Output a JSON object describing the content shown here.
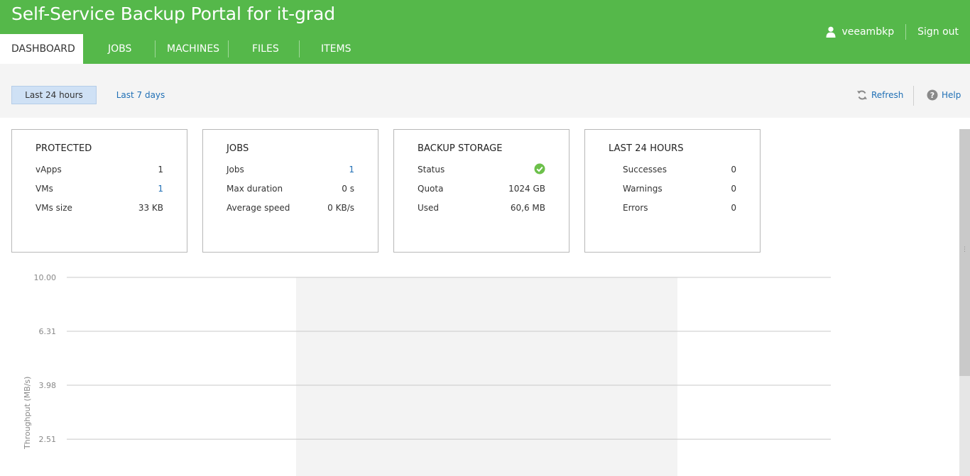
{
  "app": {
    "title": "Self-Service Backup Portal for it-grad"
  },
  "user": {
    "name": "veeambkp",
    "signout_label": "Sign out"
  },
  "nav": {
    "tabs": [
      {
        "label": "DASHBOARD",
        "active": true
      },
      {
        "label": "JOBS",
        "active": false
      },
      {
        "label": "MACHINES",
        "active": false
      },
      {
        "label": "FILES",
        "active": false
      },
      {
        "label": "ITEMS",
        "active": false
      }
    ]
  },
  "toolbar": {
    "range_24h": "Last 24 hours",
    "range_7d": "Last 7 days",
    "refresh_label": "Refresh",
    "help_label": "Help"
  },
  "cards": {
    "protected": {
      "title": "PROTECTED",
      "rows": [
        {
          "label": "vApps",
          "value": "1"
        },
        {
          "label": "VMs",
          "value": "1"
        },
        {
          "label": "VMs size",
          "value": "33 KB"
        }
      ]
    },
    "jobs": {
      "title": "JOBS",
      "rows": [
        {
          "label": "Jobs",
          "value": "1"
        },
        {
          "label": "Max duration",
          "value": "0 s"
        },
        {
          "label": "Average speed",
          "value": "0 KB/s"
        }
      ]
    },
    "storage": {
      "title": "BACKUP STORAGE",
      "rows": [
        {
          "label": "Status",
          "value": "ok"
        },
        {
          "label": "Quota",
          "value": "1024 GB"
        },
        {
          "label": "Used",
          "value": "60,6 MB"
        }
      ]
    },
    "last24": {
      "title": "LAST 24 HOURS",
      "rows": [
        {
          "label": "Successes",
          "value": "0"
        },
        {
          "label": "Warnings",
          "value": "0"
        },
        {
          "label": "Errors",
          "value": "0"
        }
      ]
    }
  },
  "colors": {
    "header_green": "#55b84a",
    "link_blue": "#1f6fb5",
    "status_ok": "#6cc04a"
  },
  "chart_data": {
    "type": "area",
    "ylabel": "Throughput (MB/s)",
    "y_scale": "log",
    "yticks": [
      "10.00",
      "6.31",
      "3.98",
      "2.51"
    ],
    "grid": true,
    "series": []
  }
}
